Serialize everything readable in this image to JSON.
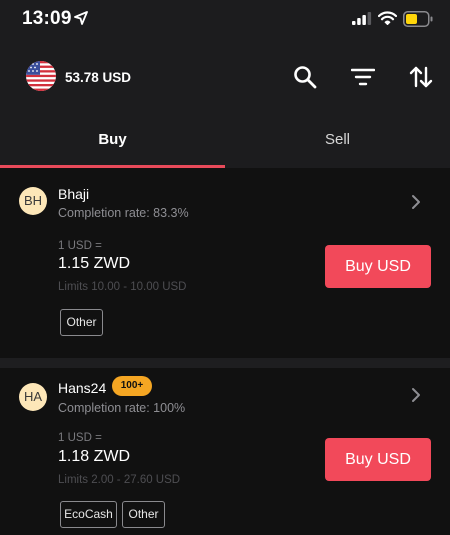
{
  "status_bar": {
    "time": "13:09",
    "icons": [
      "location-arrow-icon",
      "signal-icon",
      "wifi-icon",
      "battery-icon"
    ]
  },
  "header": {
    "balance": "53.78 USD",
    "icons": [
      "us-flag-icon",
      "search-icon",
      "filter-icon",
      "sort-icon"
    ]
  },
  "tabs": [
    {
      "label": "Buy",
      "active": true
    },
    {
      "label": "Sell",
      "active": false
    }
  ],
  "offers": [
    {
      "avatar": "BH",
      "name": "Bhaji",
      "badge": "",
      "completion": "Completion rate: 83.3%",
      "rate_label": "1 USD =",
      "price": "1.15 ZWD",
      "limits": "Limits 10.00 - 10.00 USD",
      "button": "Buy USD",
      "payment_methods": [
        "Other"
      ]
    },
    {
      "avatar": "HA",
      "name": "Hans24",
      "badge": "100+",
      "completion": "Completion rate: 100%",
      "rate_label": "1 USD =",
      "price": "1.18 ZWD",
      "limits": "Limits 2.00 - 27.60 USD",
      "button": "Buy USD",
      "payment_methods": [
        "EcoCash",
        "Other"
      ]
    }
  ],
  "colors": {
    "accent_red": "#f2495a",
    "tab_underline": "#e84a5a",
    "badge_orange": "#f5a623",
    "avatar_bg": "#fde7b8",
    "background": "#111111",
    "header_bg": "#1c1c1e"
  }
}
